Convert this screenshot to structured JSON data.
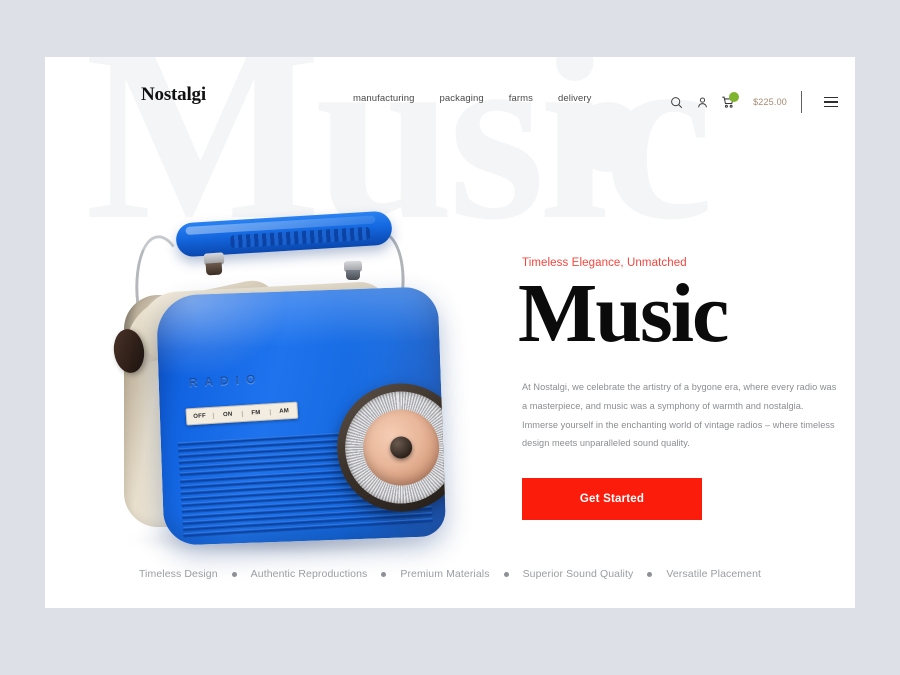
{
  "brand": {
    "name": "Nostalgi"
  },
  "nav": {
    "items": [
      {
        "label": "manufacturing"
      },
      {
        "label": "packaging"
      },
      {
        "label": "farms"
      },
      {
        "label": "delivery"
      }
    ]
  },
  "actions": {
    "search_icon": "search-icon",
    "account_icon": "account-icon",
    "cart_icon": "cart-icon",
    "cart_price": "$225.00",
    "menu_icon": "hamburger-menu-icon",
    "badge_color": "#7fb42d",
    "price_color": "#a8896f"
  },
  "hero": {
    "eyebrow": "Timeless Elegance, Unmatched",
    "headline": "Music",
    "watermark": "Music",
    "paragraph": "At Nostalgi, we celebrate the artistry of a bygone era, where every radio was a masterpiece, and music was a symphony of warmth and nostalgia. Immerse yourself in the enchanting world of vintage radios – where timeless design meets unparalleled sound quality.",
    "cta_label": "Get Started",
    "eyebrow_color": "#f8443c",
    "cta_color": "#fb1c0b"
  },
  "product": {
    "name": "vintage-blue-radio",
    "brand_emboss": "RADIO",
    "switches": [
      "OFF",
      "ON",
      "FM",
      "AM"
    ],
    "body_color": "#1468df",
    "accent_color": "#e8dfcd"
  },
  "features": {
    "items": [
      {
        "label": "Timeless Design"
      },
      {
        "label": "Authentic Reproductions"
      },
      {
        "label": "Premium Materials"
      },
      {
        "label": "Superior Sound Quality"
      },
      {
        "label": "Versatile Placement"
      }
    ]
  }
}
